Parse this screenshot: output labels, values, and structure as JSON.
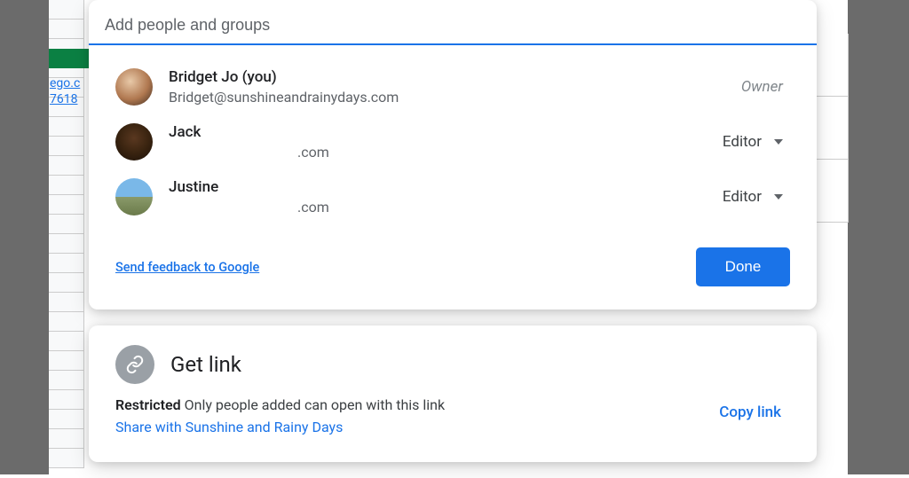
{
  "background": {
    "visible_link_lines": [
      "ego.c",
      "7618"
    ]
  },
  "share_dialog": {
    "add_people_placeholder": "Add people and groups",
    "people": [
      {
        "name": "Bridget Jo (you)",
        "email": "Bridget@sunshineandrainydays.com",
        "role": "Owner",
        "is_owner": true
      },
      {
        "name": "Jack",
        "email": ".com",
        "role": "Editor",
        "is_owner": false
      },
      {
        "name": "Justine",
        "email": ".com",
        "role": "Editor",
        "is_owner": false
      }
    ],
    "feedback_label": "Send feedback to Google",
    "done_label": "Done"
  },
  "get_link": {
    "title": "Get link",
    "restricted_bold": "Restricted",
    "restricted_text": " Only people added can open with this link",
    "share_org_label": "Share with Sunshine and Rainy Days",
    "copy_link_label": "Copy link"
  }
}
